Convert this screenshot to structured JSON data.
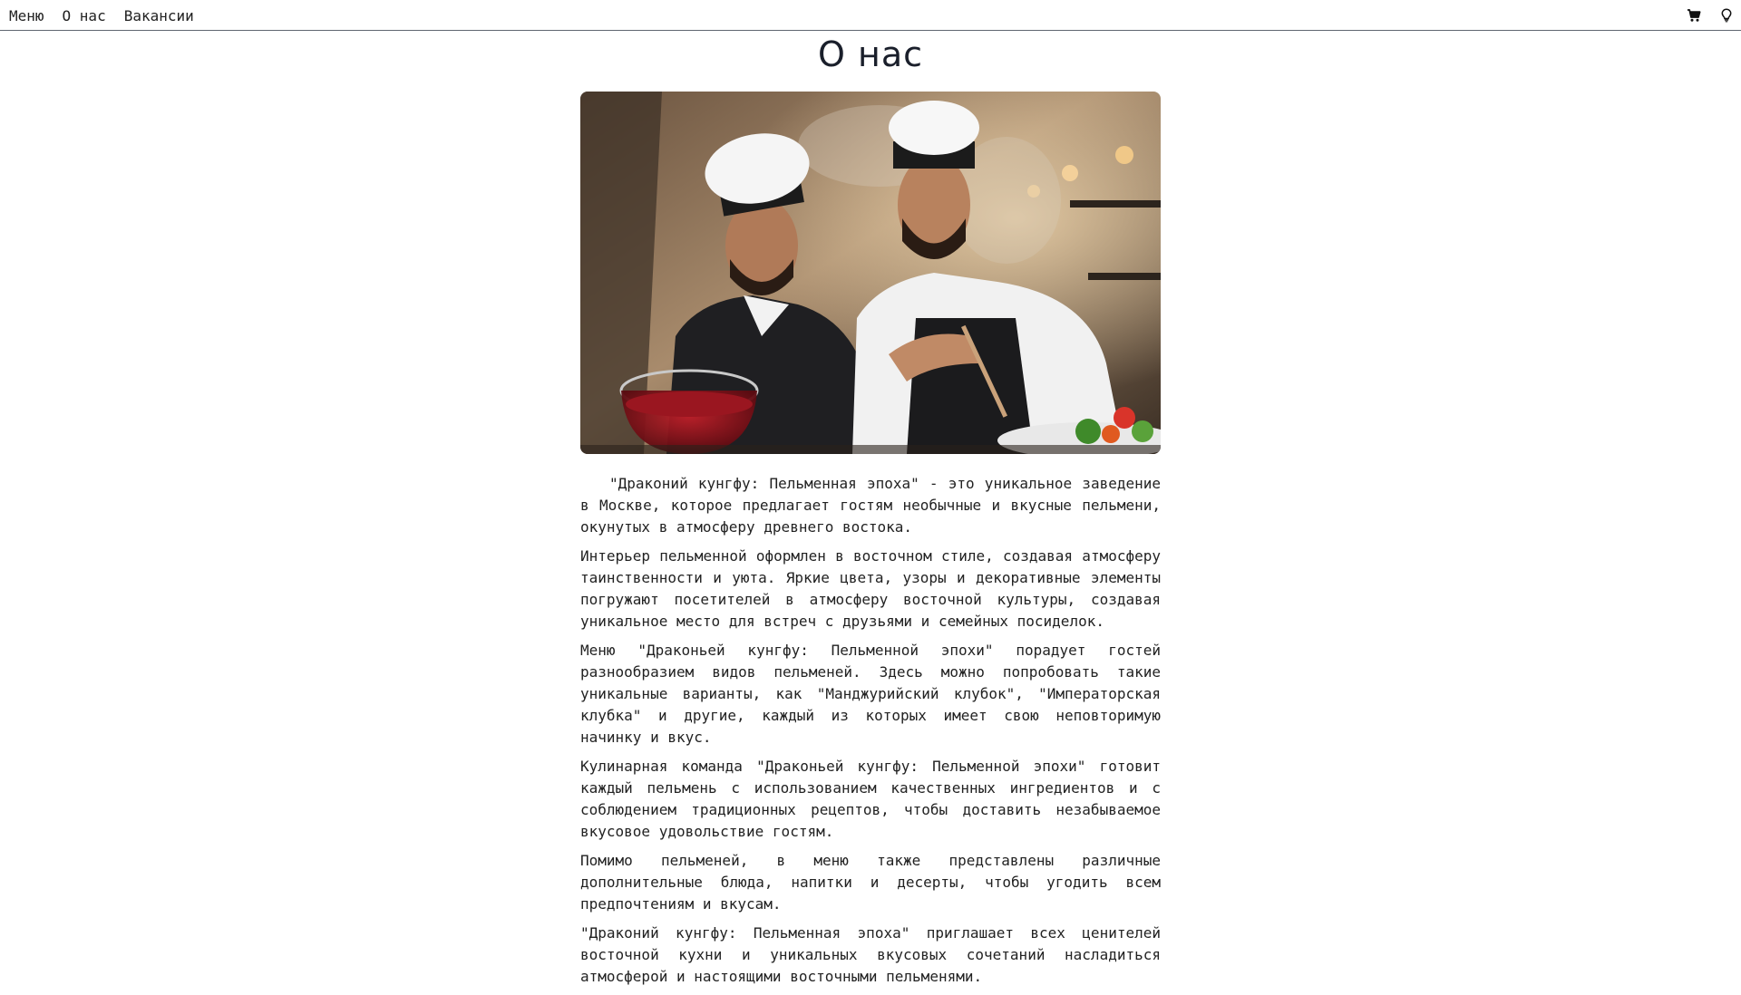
{
  "nav": {
    "links": [
      "Меню",
      "О нас",
      "Вакансии"
    ],
    "icons": [
      "cart-icon",
      "lightbulb-icon"
    ]
  },
  "page": {
    "title": "О нас"
  },
  "hero_image": {
    "description_icon": "chefs-photo"
  },
  "article": {
    "paragraphs": [
      "\"Драконий кунгфу: Пельменная эпоха\" - это уникальное заведение в Москве, которое предлагает гостям необычные и вкусные пельмени, окунутых в атмосферу древнего востока.",
      "Интерьер пельменной оформлен в восточном стиле, создавая атмосферу таинственности и уюта. Яркие цвета, узоры и декоративные элементы погружают посетителей в атмосферу восточной культуры, создавая уникальное место для встреч с друзьями и семейных посиделок.",
      "Меню \"Драконьей кунгфу: Пельменной эпохи\" порадует гостей разнообразием видов пельменей. Здесь можно попробовать такие уникальные варианты, как \"Манджурийский клубок\", \"Императорская клубка\" и другие, каждый из которых имеет свою неповторимую начинку и вкус.",
      "Кулинарная команда \"Драконьей кунгфу: Пельменной эпохи\" готовит каждый пельмень с использованием качественных ингредиентов и с соблюдением традиционных рецептов, чтобы доставить незабываемое вкусовое удовольствие гостям.",
      "Помимо пельменей, в меню также представлены различные дополнительные блюда, напитки и десерты, чтобы угодить всем предпочтениям и вкусам.",
      "\"Драконий кунгфу: Пельменная эпоха\" приглашает всех ценителей восточной кухни и уникальных вкусовых сочетаний насладиться атмосферой и настоящими восточными пельменями."
    ]
  },
  "colors": {
    "nav_border": "#5f6670",
    "title": "#1a1f2b",
    "text": "#222222"
  }
}
